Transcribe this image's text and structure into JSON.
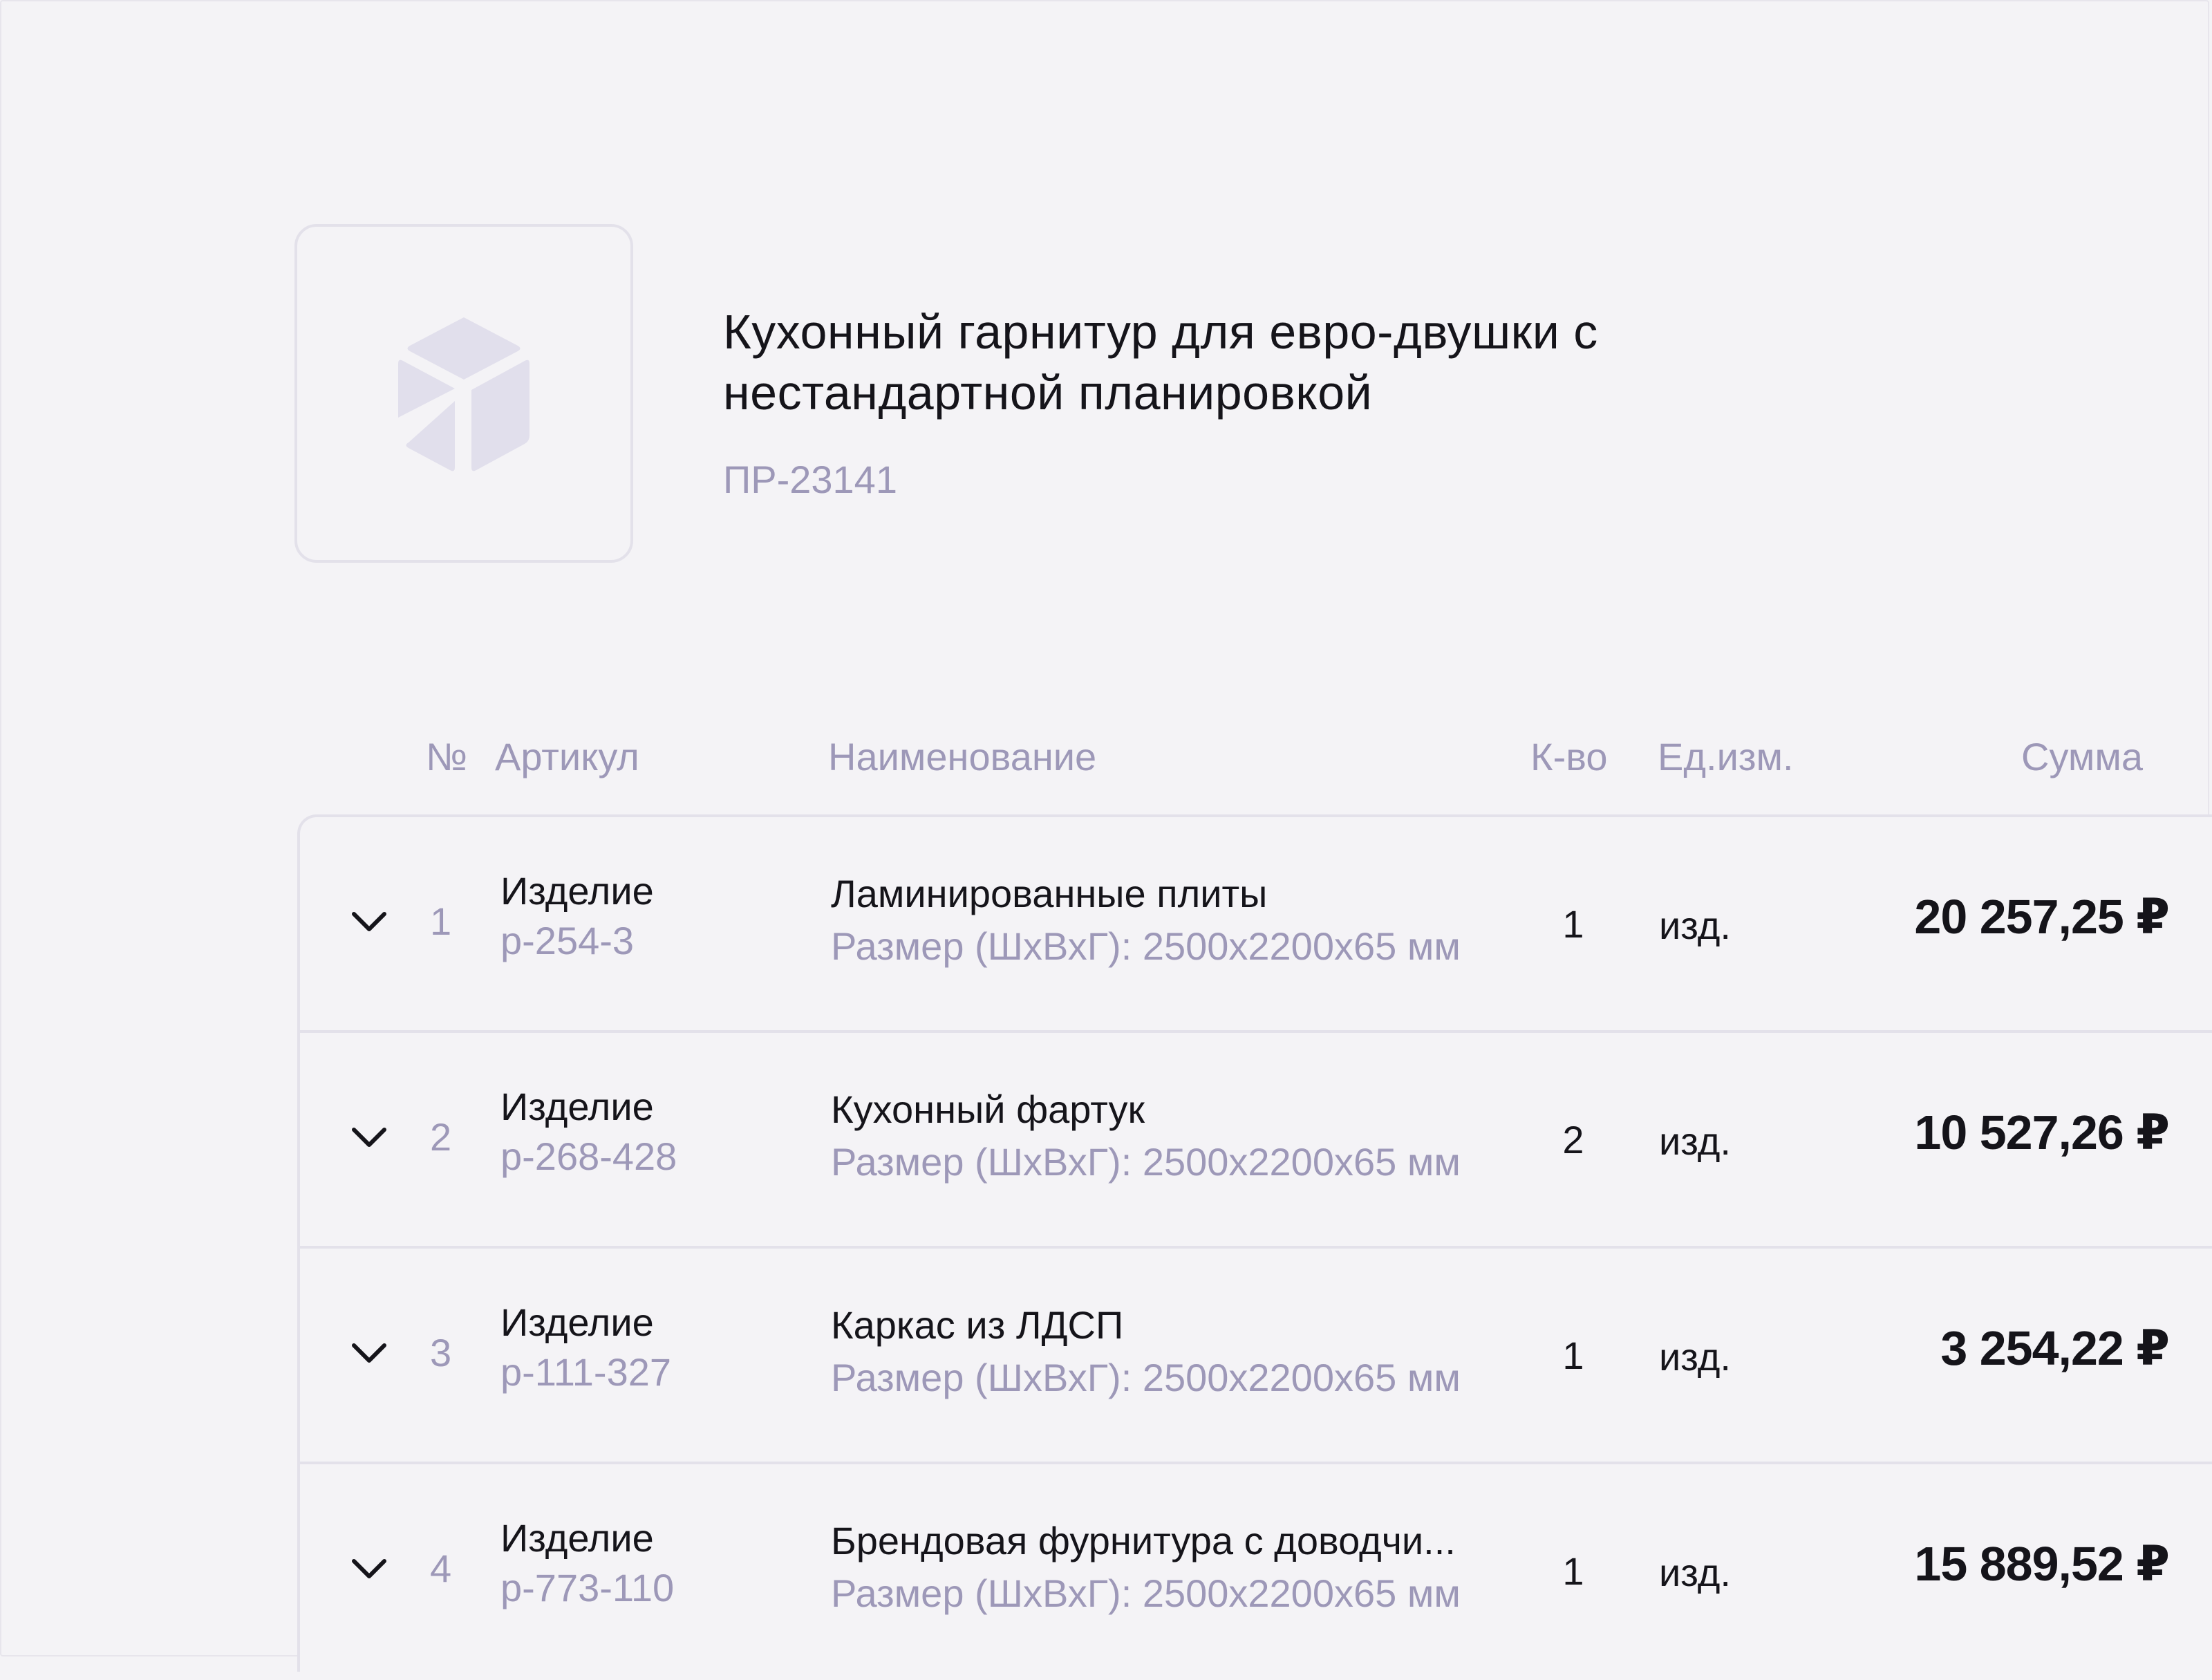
{
  "product": {
    "title": "Кухонный гарнитур для евро-двушки с нестандартной планировкой",
    "code": "ПР-23141",
    "thumbnail_icon": "package-box-icon"
  },
  "table": {
    "headers": {
      "num": "№",
      "article": "Артикул",
      "name": "Наименование",
      "qty": "К-во",
      "unit": "Ед.изм.",
      "sum": "Сумма"
    },
    "rows": [
      {
        "num": "1",
        "kind": "Изделие",
        "article": "р-254-3",
        "name": "Ламинированные плиты",
        "size": "Размер (ШхВхГ): 2500х2200х65 мм",
        "qty": "1",
        "unit": "изд.",
        "sum": "20 257,25 ₽"
      },
      {
        "num": "2",
        "kind": "Изделие",
        "article": "р-268-428",
        "name": "Кухонный фартук",
        "size": "Размер (ШхВхГ): 2500х2200х65 мм",
        "qty": "2",
        "unit": "изд.",
        "sum": "10 527,26 ₽"
      },
      {
        "num": "3",
        "kind": "Изделие",
        "article": "р-111-327",
        "name": "Каркас из ЛДСП",
        "size": "Размер (ШхВхГ): 2500х2200х65 мм",
        "qty": "1",
        "unit": "изд.",
        "sum": "3 254,22 ₽"
      },
      {
        "num": "4",
        "kind": "Изделие",
        "article": "р-773-110",
        "name": "Брендовая фурнитура с доводчи...",
        "size": "Размер (ШхВхГ): 2500х2200х65 мм",
        "qty": "1",
        "unit": "изд.",
        "sum": "15 889,52 ₽"
      }
    ]
  },
  "colors": {
    "background": "#f4f3f6",
    "text_primary": "#15141a",
    "text_secondary": "#9d98b8",
    "border": "#e3e1ea",
    "icon_fill": "#e1dfec"
  }
}
